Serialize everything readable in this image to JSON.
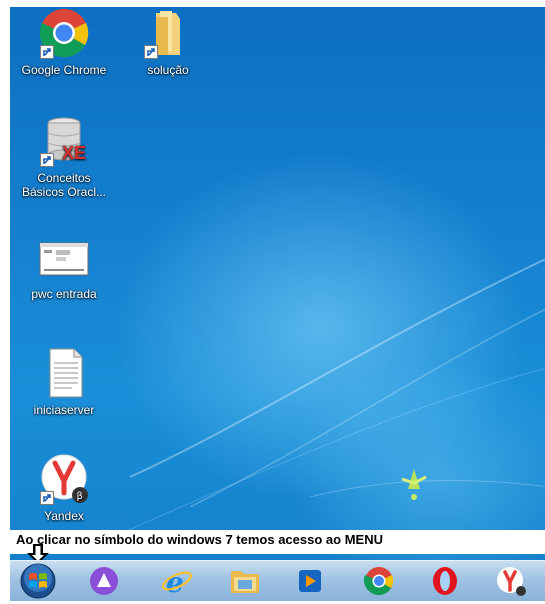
{
  "desktop": {
    "icons": [
      {
        "label": "Google Chrome"
      },
      {
        "label": "solução"
      },
      {
        "label_line1": "Conceitos",
        "label_line2": "Básicos Oracl..."
      },
      {
        "label": "pwc entrada"
      },
      {
        "label": "iniciaserver"
      },
      {
        "label": "Yandex"
      }
    ]
  },
  "caption": {
    "text": "Ao clicar no símbolo do windows 7 temos acesso ao MENU"
  },
  "taskbar": {
    "items": [
      "start-orb",
      "alice-icon",
      "internet-explorer-icon",
      "file-explorer-icon",
      "media-player-icon",
      "google-chrome-icon",
      "opera-icon",
      "yandex-icon"
    ]
  },
  "colors": {
    "desktop_blue": "#1480cf",
    "taskbar": "#9fc2e3",
    "chrome_red": "#db4437",
    "chrome_yellow": "#f4c20d",
    "chrome_green": "#0f9d58",
    "chrome_blue": "#4285f4"
  }
}
